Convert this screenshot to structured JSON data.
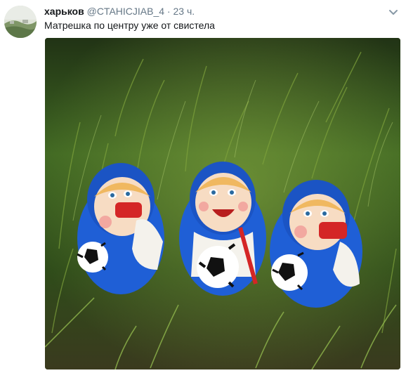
{
  "tweet": {
    "author_name": "харьков",
    "author_handle": "@CTAHICJIAB_4",
    "separator": "·",
    "timestamp": "23 ч.",
    "text": "Матрешка по центру уже от свистела"
  },
  "icons": {
    "avatar": "user-avatar-landscape",
    "menu": "chevron-down-icon"
  },
  "media": {
    "description_icon": "photo-of-three-football-matryoshka-dolls-on-grass"
  },
  "colors": {
    "name": "#14171a",
    "secondary_text": "#657786",
    "doll_blue": "#1f5fd6",
    "grass": "#4f7a2a"
  }
}
